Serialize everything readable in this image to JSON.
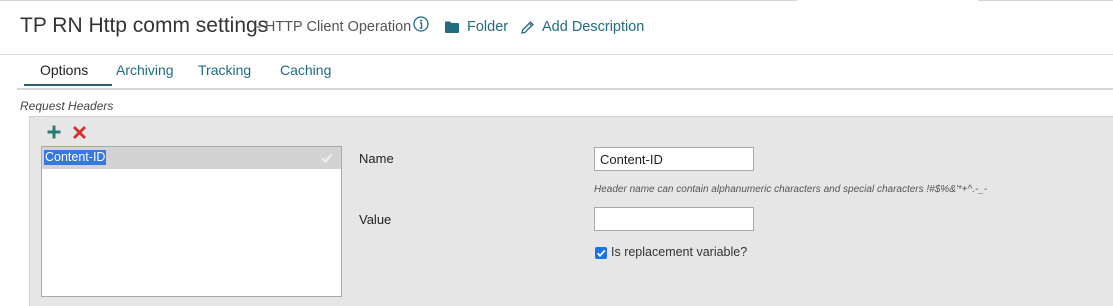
{
  "header": {
    "title": "TP RN Http comm settings",
    "subtitle_dash": "-",
    "subtitle": "HTTP Client Operation",
    "folder_label": "Folder",
    "add_description_label": "Add Description"
  },
  "tabs": [
    {
      "label": "Options",
      "active": true
    },
    {
      "label": "Archiving",
      "active": false
    },
    {
      "label": "Tracking",
      "active": false
    },
    {
      "label": "Caching",
      "active": false
    }
  ],
  "request_headers": {
    "section_label": "Request Headers",
    "items": [
      {
        "label": "Content-ID",
        "selected": true
      }
    ]
  },
  "form": {
    "name_label": "Name",
    "name_value": "Content-ID",
    "name_hint": "Header name can contain alphanumeric characters and special characters !#$%&'*+^.-_-",
    "value_label": "Value",
    "value_value": "",
    "replacement_label": "Is replacement variable?",
    "replacement_checked": true
  },
  "colors": {
    "accent": "#1f6b80",
    "add_icon": "#2a7d6e",
    "delete_icon": "#d0312d",
    "checkbox": "#1a73e8",
    "selection": "#3578e5"
  }
}
